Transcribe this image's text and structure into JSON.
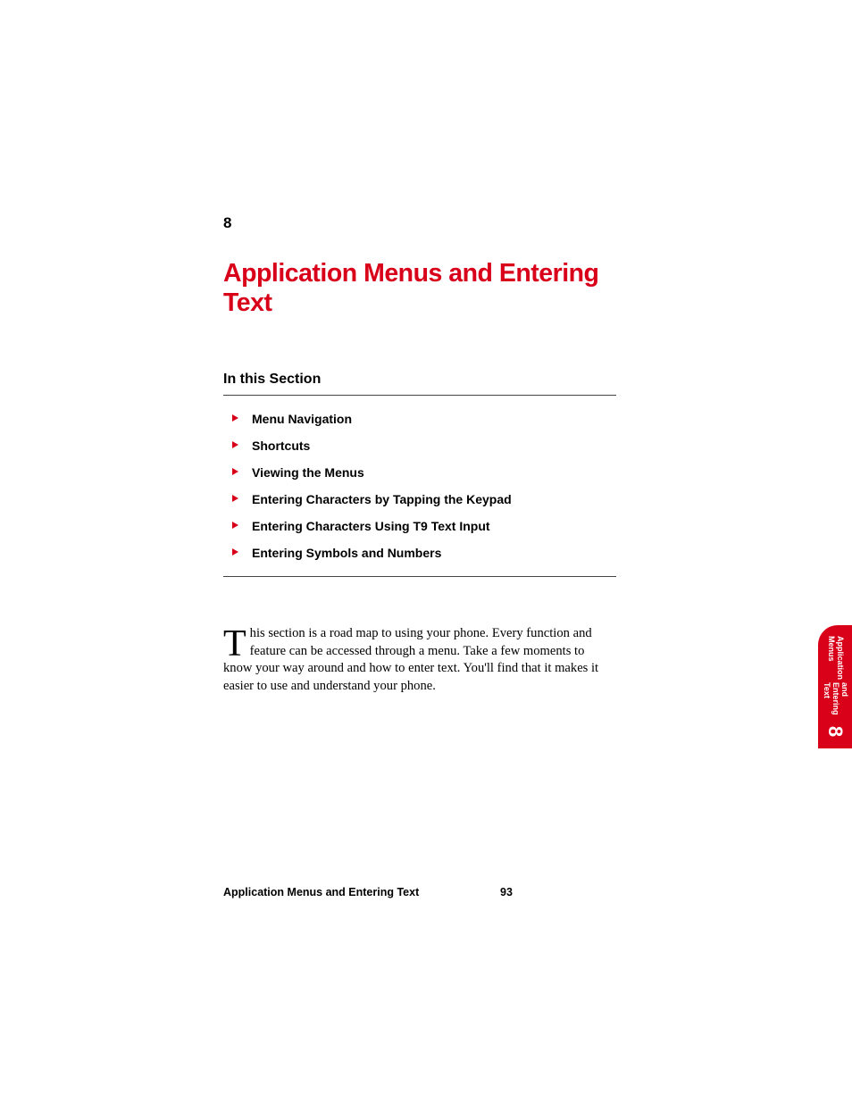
{
  "chapter": {
    "number": "8",
    "title": "Application Menus and Entering Text"
  },
  "section_heading": "In this Section",
  "toc": [
    "Menu Navigation",
    "Shortcuts",
    "Viewing the Menus",
    "Entering Characters by Tapping the Keypad",
    "Entering Characters Using T9 Text Input",
    "Entering Symbols and Numbers"
  ],
  "body": {
    "dropcap": "T",
    "text": "his section is a road map to using your phone. Every function and feature can be accessed through a menu. Take a few moments to know your way around and how to enter text. You'll find that it makes it easier to use and understand your phone."
  },
  "footer": {
    "label": "Application Menus and Entering Text",
    "page": "93"
  },
  "tab": {
    "line1": "Application Menus",
    "line2": "and Entering Text",
    "number": "8"
  }
}
